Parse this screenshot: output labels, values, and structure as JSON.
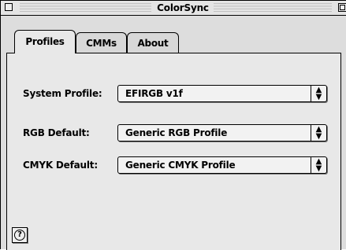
{
  "window": {
    "title": "ColorSync"
  },
  "tabs": [
    {
      "label": "Profiles",
      "active": true
    },
    {
      "label": "CMMs",
      "active": false
    },
    {
      "label": "About",
      "active": false
    }
  ],
  "settings": [
    {
      "label": "System Profile:",
      "value": "EFIRGB v1f"
    },
    {
      "label": "RGB Default:",
      "value": "Generic RGB Profile"
    },
    {
      "label": "CMYK Default:",
      "value": "Generic CMYK Profile"
    }
  ],
  "help": {
    "glyph": "?"
  }
}
